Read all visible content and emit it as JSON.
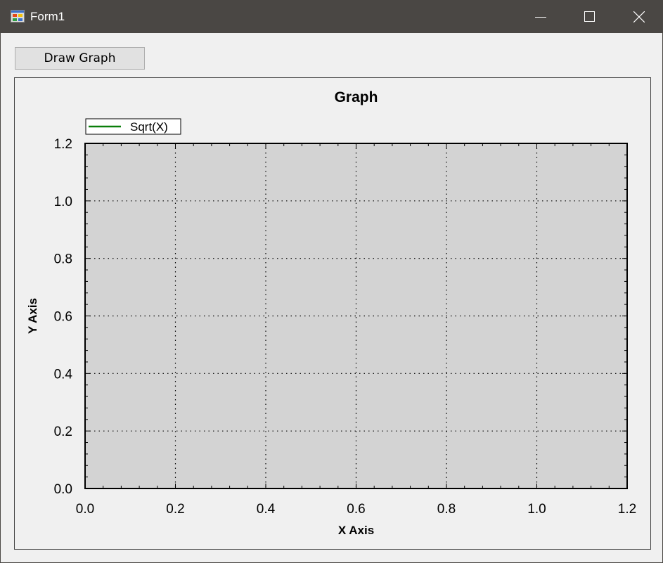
{
  "window": {
    "title": "Form1",
    "icons": {
      "app": "app-icon",
      "minimize": "minimize-icon",
      "maximize": "maximize-icon",
      "close": "close-icon"
    }
  },
  "toolbar": {
    "draw_graph_label": "Draw Graph"
  },
  "colors": {
    "titlebar": "#4a4744",
    "plot_background": "#d3d3d3",
    "series_line": "#0a7f0a"
  },
  "chart_data": {
    "type": "line",
    "title": "Graph",
    "xlabel": "X Axis",
    "ylabel": "Y Axis",
    "xlim": [
      0.0,
      1.2
    ],
    "ylim": [
      0.0,
      1.2
    ],
    "x_ticks": [
      "0.0",
      "0.2",
      "0.4",
      "0.6",
      "0.8",
      "1.0",
      "1.2"
    ],
    "y_ticks": [
      "0.0",
      "0.2",
      "0.4",
      "0.6",
      "0.8",
      "1.0",
      "1.2"
    ],
    "grid": true,
    "legend_position": "top-left",
    "series": [
      {
        "name": "Sqrt(X)",
        "x": [],
        "y": []
      }
    ]
  }
}
